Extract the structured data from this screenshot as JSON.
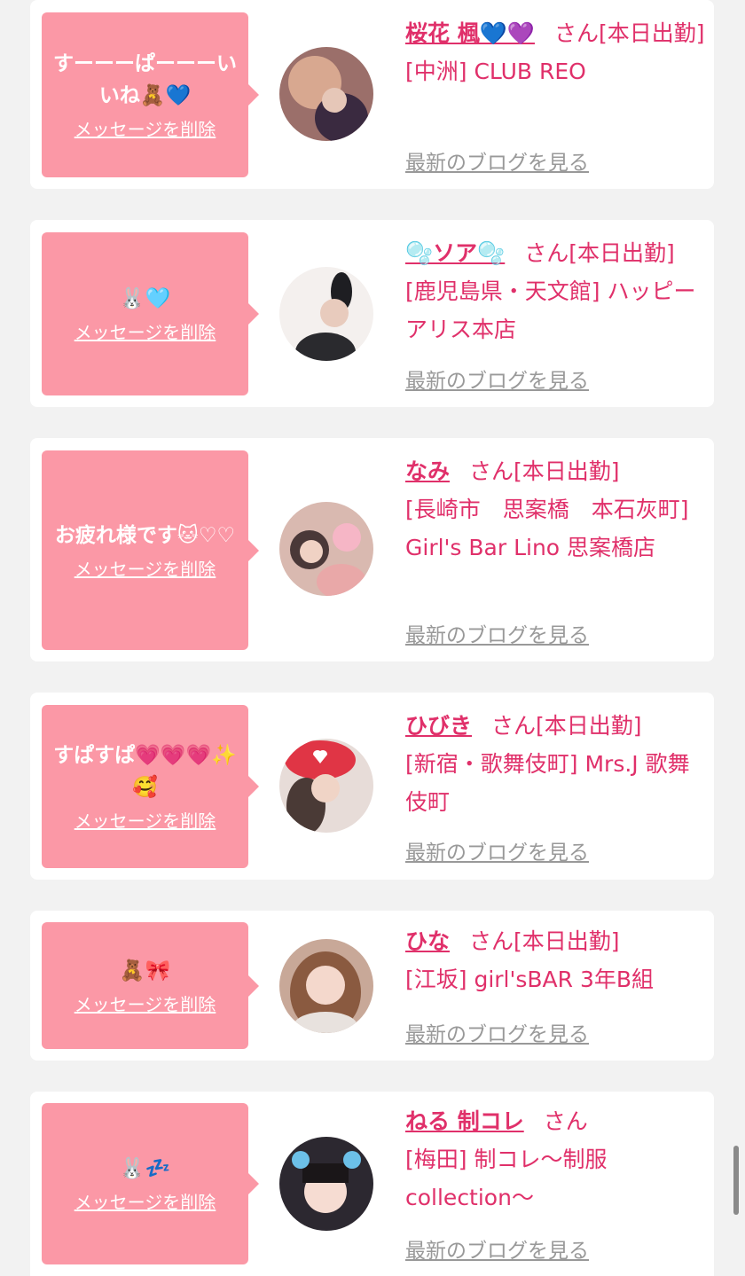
{
  "delete_label": "メッセージを削除",
  "blog_label": "最新のブログを見る",
  "san_label": "さん",
  "entries": [
    {
      "message": "すーーーぱーーーいいね🧸💙",
      "name": "桜花 楓💙💜",
      "status": "[本日出勤]",
      "area": "[中洲]",
      "shop": "CLUB REO"
    },
    {
      "message": "🐰🩵",
      "name": "🫧ソア🫧",
      "status": "[本日出勤]",
      "area": "[鹿児島県・天文館]",
      "shop": "ハッピーアリス本店"
    },
    {
      "message": "お疲れ様です🐱♡♡",
      "name": "なみ",
      "status": "[本日出勤]",
      "area": "[長崎市　思案橋　本石灰町]",
      "shop": "Girl's Bar Lino 思案橋店"
    },
    {
      "message": "すぱすぱ💗💗💗✨🥰",
      "name": "ひびき",
      "status": "[本日出勤]",
      "area": "[新宿・歌舞伎町]",
      "shop": "Mrs.J 歌舞伎町"
    },
    {
      "message": "🧸🎀",
      "name": "ひな",
      "status": "[本日出勤]",
      "area": "[江坂]",
      "shop": "girl'sBAR 3年B組"
    },
    {
      "message": "🐰💤",
      "name": "ねる 制コレ",
      "status": "",
      "area": "[梅田]",
      "shop": "制コレ〜制服collection〜"
    }
  ],
  "colors": {
    "accent": "#e0306a",
    "bubble": "#fb98a6",
    "muted": "#999999",
    "background": "#f2f2f2"
  }
}
